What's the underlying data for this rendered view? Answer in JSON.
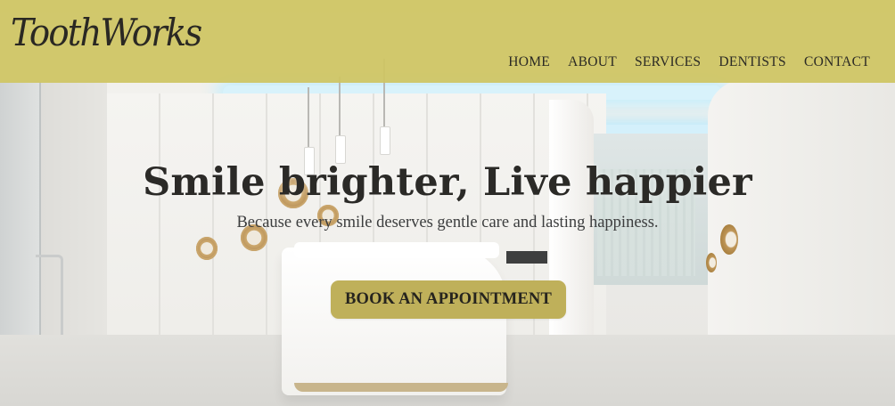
{
  "brand": {
    "logo_text": "ToothWorks"
  },
  "nav": {
    "items": [
      {
        "label": "HOME"
      },
      {
        "label": "ABOUT"
      },
      {
        "label": "SERVICES"
      },
      {
        "label": "DENTISTS"
      },
      {
        "label": "CONTACT"
      }
    ]
  },
  "hero": {
    "title": "Smile brighter, Live happier",
    "subtitle": "Because every smile deserves gentle care and lasting happiness.",
    "cta_label": "BOOK AN APPOINTMENT"
  },
  "colors": {
    "header_bg": "#cfc562",
    "cta_bg": "#bfb05a",
    "text_dark": "#2b2a27"
  }
}
